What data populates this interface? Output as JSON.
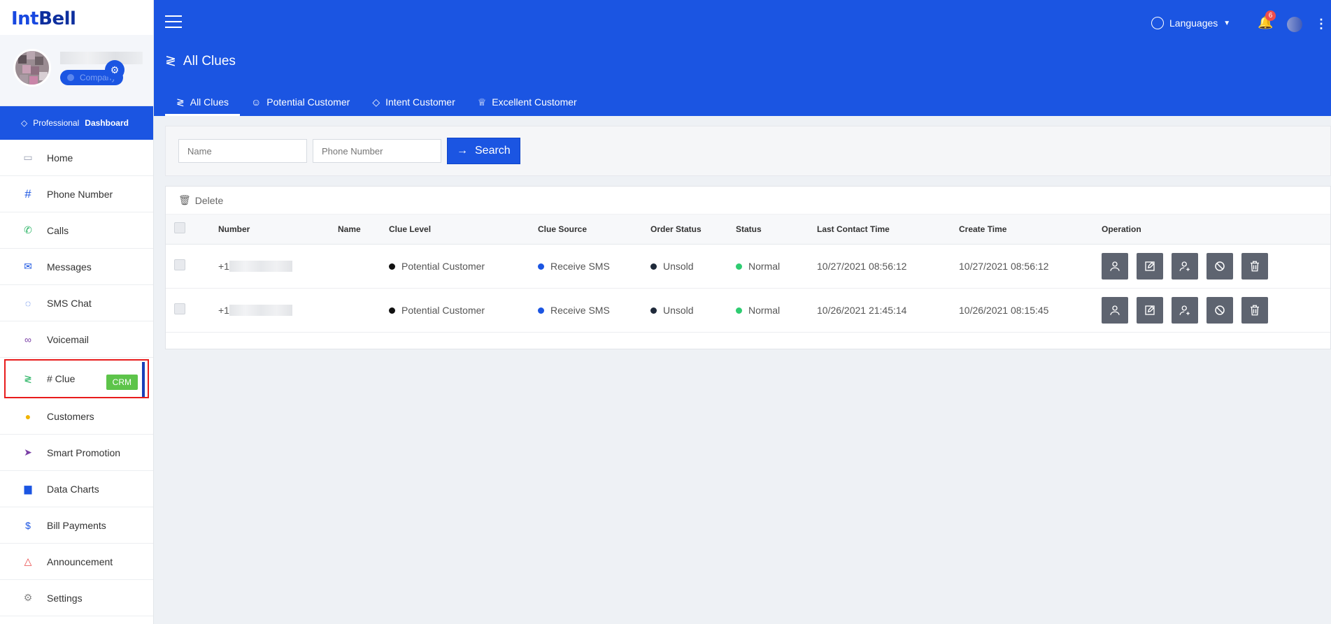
{
  "brand": {
    "part1": "Int",
    "part2": "Bell"
  },
  "user": {
    "badge": "Company"
  },
  "pro_bar": {
    "label": "Professional",
    "bold": "Dashboard"
  },
  "nav": [
    {
      "label": "Home",
      "icon": "monitor-icon",
      "color": "#9aa0b3"
    },
    {
      "label": "Phone Number",
      "icon": "hash-icon",
      "color": "#1b55e2"
    },
    {
      "label": "Calls",
      "icon": "phone-icon",
      "color": "#28b463"
    },
    {
      "label": "Messages",
      "icon": "mail-icon",
      "color": "#1b55e2"
    },
    {
      "label": "SMS Chat",
      "icon": "chat-icon",
      "color": "#1b55e2"
    },
    {
      "label": "Voicemail",
      "icon": "voicemail-icon",
      "color": "#7a3fa6"
    },
    {
      "label": "# Clue",
      "icon": "route-icon",
      "color": "#28b463",
      "badge": "CRM"
    },
    {
      "label": "Customers",
      "icon": "user-circle-icon",
      "color": "#f0b400"
    },
    {
      "label": "Smart Promotion",
      "icon": "send-icon",
      "color": "#7a3fa6"
    },
    {
      "label": "Data Charts",
      "icon": "bar-chart-icon",
      "color": "#1b55e2"
    },
    {
      "label": "Bill Payments",
      "icon": "dollar-icon",
      "color": "#1b55e2"
    },
    {
      "label": "Announcement",
      "icon": "bell-outline-icon",
      "color": "#e84545"
    },
    {
      "label": "Settings",
      "icon": "gears-icon",
      "color": "#888"
    }
  ],
  "header": {
    "languages": "Languages",
    "notif_count": "6",
    "page_title": "All Clues",
    "tabs": [
      "All Clues",
      "Potential Customer",
      "Intent Customer",
      "Excellent Customer"
    ]
  },
  "search": {
    "name_placeholder": "Name",
    "phone_placeholder": "Phone Number",
    "button": "Search"
  },
  "table": {
    "delete": "Delete",
    "columns": [
      "Number",
      "Name",
      "Clue Level",
      "Clue Source",
      "Order Status",
      "Status",
      "Last Contact Time",
      "Create Time",
      "Operation"
    ],
    "rows": [
      {
        "number_prefix": "+1",
        "name": "",
        "clue_level": "Potential Customer",
        "clue_source": "Receive SMS",
        "order_status": "Unsold",
        "status": "Normal",
        "last_contact": "10/27/2021 08:56:12",
        "create_time": "10/27/2021 08:56:12"
      },
      {
        "number_prefix": "+1",
        "name": "",
        "clue_level": "Potential Customer",
        "clue_source": "Receive SMS",
        "order_status": "Unsold",
        "status": "Normal",
        "last_contact": "10/26/2021 21:45:14",
        "create_time": "10/26/2021 08:15:45"
      }
    ],
    "colors": {
      "clue_level": "#111111",
      "clue_source": "#1b55e2",
      "order_status": "#1f2a3a",
      "status": "#2ecc71"
    }
  }
}
